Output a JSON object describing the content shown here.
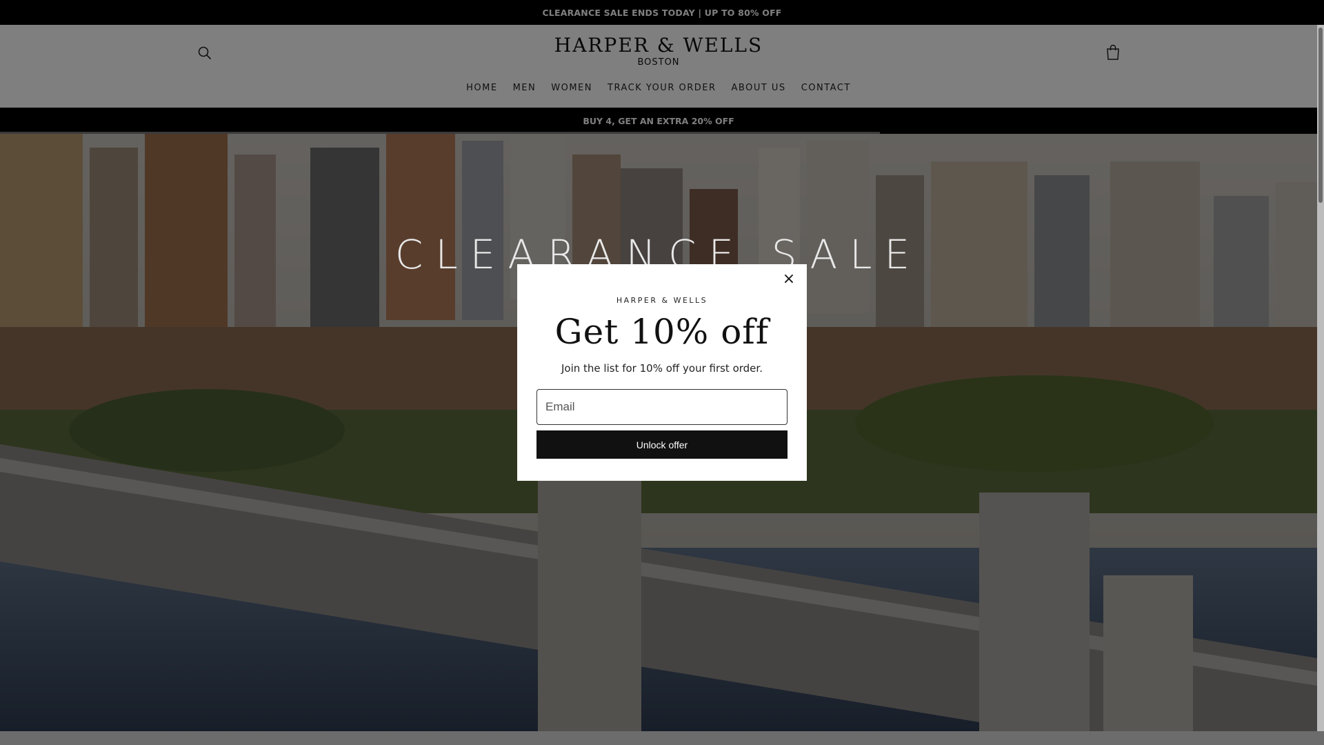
{
  "announcement": "CLEARANCE SALE ENDS TODAY | UP TO 80% OFF",
  "header": {
    "logo_main": "HARPER & WELLS",
    "logo_sub": "BOSTON",
    "nav": [
      "HOME",
      "MEN",
      "WOMEN",
      "TRACK YOUR ORDER",
      "ABOUT US",
      "CONTACT"
    ]
  },
  "promo": "BUY 4, GET AN EXTRA 20% OFF",
  "hero": {
    "title": "CLEARANCE SALE"
  },
  "popup": {
    "brand": "HARPER & WELLS",
    "heading": "Get 10% off",
    "subtext": "Join the list for 10% off your first order.",
    "email_placeholder": "Email",
    "button": "Unlock offer",
    "close": "×"
  },
  "colors": {
    "announcement_bg": "#000000",
    "cta_green": "#17a27b",
    "button_dark": "#111111"
  },
  "icons": {
    "search": "search-icon",
    "cart": "cart-icon",
    "close": "close-icon"
  }
}
